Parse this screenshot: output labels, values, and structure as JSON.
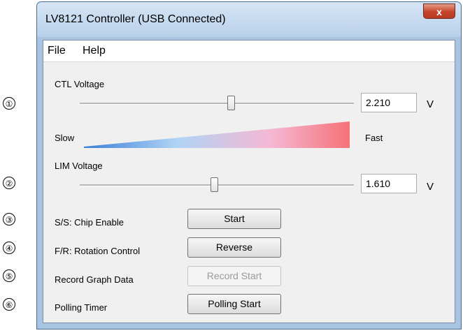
{
  "window": {
    "title": "LV8121 Controller (USB Connected)",
    "close_label": "x"
  },
  "menu": {
    "items": [
      "File",
      "Help"
    ]
  },
  "callouts": [
    "①",
    "②",
    "③",
    "④",
    "⑤",
    "⑥"
  ],
  "ctl": {
    "label": "CTL Voltage",
    "value": "2.210",
    "unit": "V",
    "slider_position": 0.55
  },
  "speed": {
    "slow_label": "Slow",
    "fast_label": "Fast"
  },
  "lim": {
    "label": "LIM Voltage",
    "value": "1.610",
    "unit": "V",
    "slider_position": 0.49
  },
  "controls": [
    {
      "label": "S/S: Chip Enable",
      "button": "Start",
      "enabled": true
    },
    {
      "label": "F/R: Rotation Control",
      "button": "Reverse",
      "enabled": true
    },
    {
      "label": "Record Graph Data",
      "button": "Record Start",
      "enabled": false
    },
    {
      "label": "Polling Timer",
      "button": "Polling Start",
      "enabled": true
    }
  ],
  "colors": {
    "slow": "#b0d4f5",
    "fast": "#f57278",
    "title_bar": "#c6dbf1",
    "close_button": "#c4452b"
  }
}
